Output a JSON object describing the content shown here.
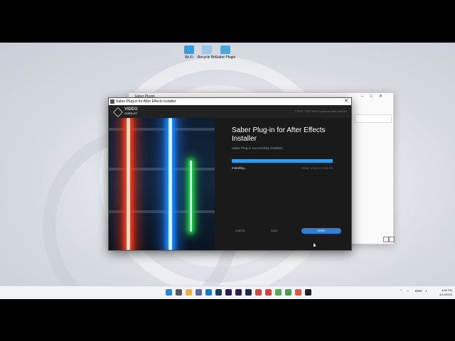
{
  "desktop": {
    "icons": [
      {
        "label": "Wi-Fi",
        "name": "monitor-icon",
        "color": "#3a9bd8"
      },
      {
        "label": "Recycle Bin",
        "name": "recycle-bin-icon",
        "color": "#9ec7e8"
      },
      {
        "label": "Saber Plugin",
        "name": "installer-icon",
        "color": "#4aa8e0"
      }
    ]
  },
  "explorer": {
    "title": "Saber Plugin"
  },
  "installer": {
    "window_title": "Saber Plug-in for After Effects Installer",
    "logo_line1": "VIDEO",
    "logo_line2": "COPILOT",
    "copyright": "© 2010 - 2022 Video Copilot and Red Giant Inc",
    "heading": "Saber Plug-in for After Effects Installer",
    "message": "Saber Plug-in successfully installed.",
    "progress": 1.0,
    "status": "Installing...",
    "size_text": "DONE! 12,500 of 12,500 KB",
    "buttons": {
      "cancel": "CANCEL",
      "back": "BACK",
      "finish": "FINISH"
    },
    "accent": "#2e9ff0"
  },
  "taskbar": {
    "apps": [
      {
        "name": "windows-start-icon",
        "color": "#1e88e5"
      },
      {
        "name": "search-icon",
        "color": "#555555"
      },
      {
        "name": "file-explorer-icon",
        "color": "#f2b134"
      },
      {
        "name": "chat-icon",
        "color": "#6264a7"
      },
      {
        "name": "edge-icon",
        "color": "#0c7bd8"
      },
      {
        "name": "photoshop-icon",
        "color": "#1d3b5e"
      },
      {
        "name": "after-effects-icon",
        "color": "#2b1d5c"
      },
      {
        "name": "premiere-icon",
        "color": "#2a1d4f"
      },
      {
        "name": "media-encoder-icon",
        "color": "#1e2b4d"
      },
      {
        "name": "chrome-icon",
        "color": "#db4437"
      },
      {
        "name": "bolt-app-icon",
        "color": "#e53935"
      },
      {
        "name": "android-app-icon",
        "color": "#4caf50"
      },
      {
        "name": "camtasia-icon",
        "color": "#43a047"
      },
      {
        "name": "presentation-app-icon",
        "color": "#e5533d"
      },
      {
        "name": "installer-app-icon",
        "color": "#222222"
      }
    ],
    "lang": "ENG",
    "time": "3:26 PM",
    "date": "4/14/2022"
  }
}
